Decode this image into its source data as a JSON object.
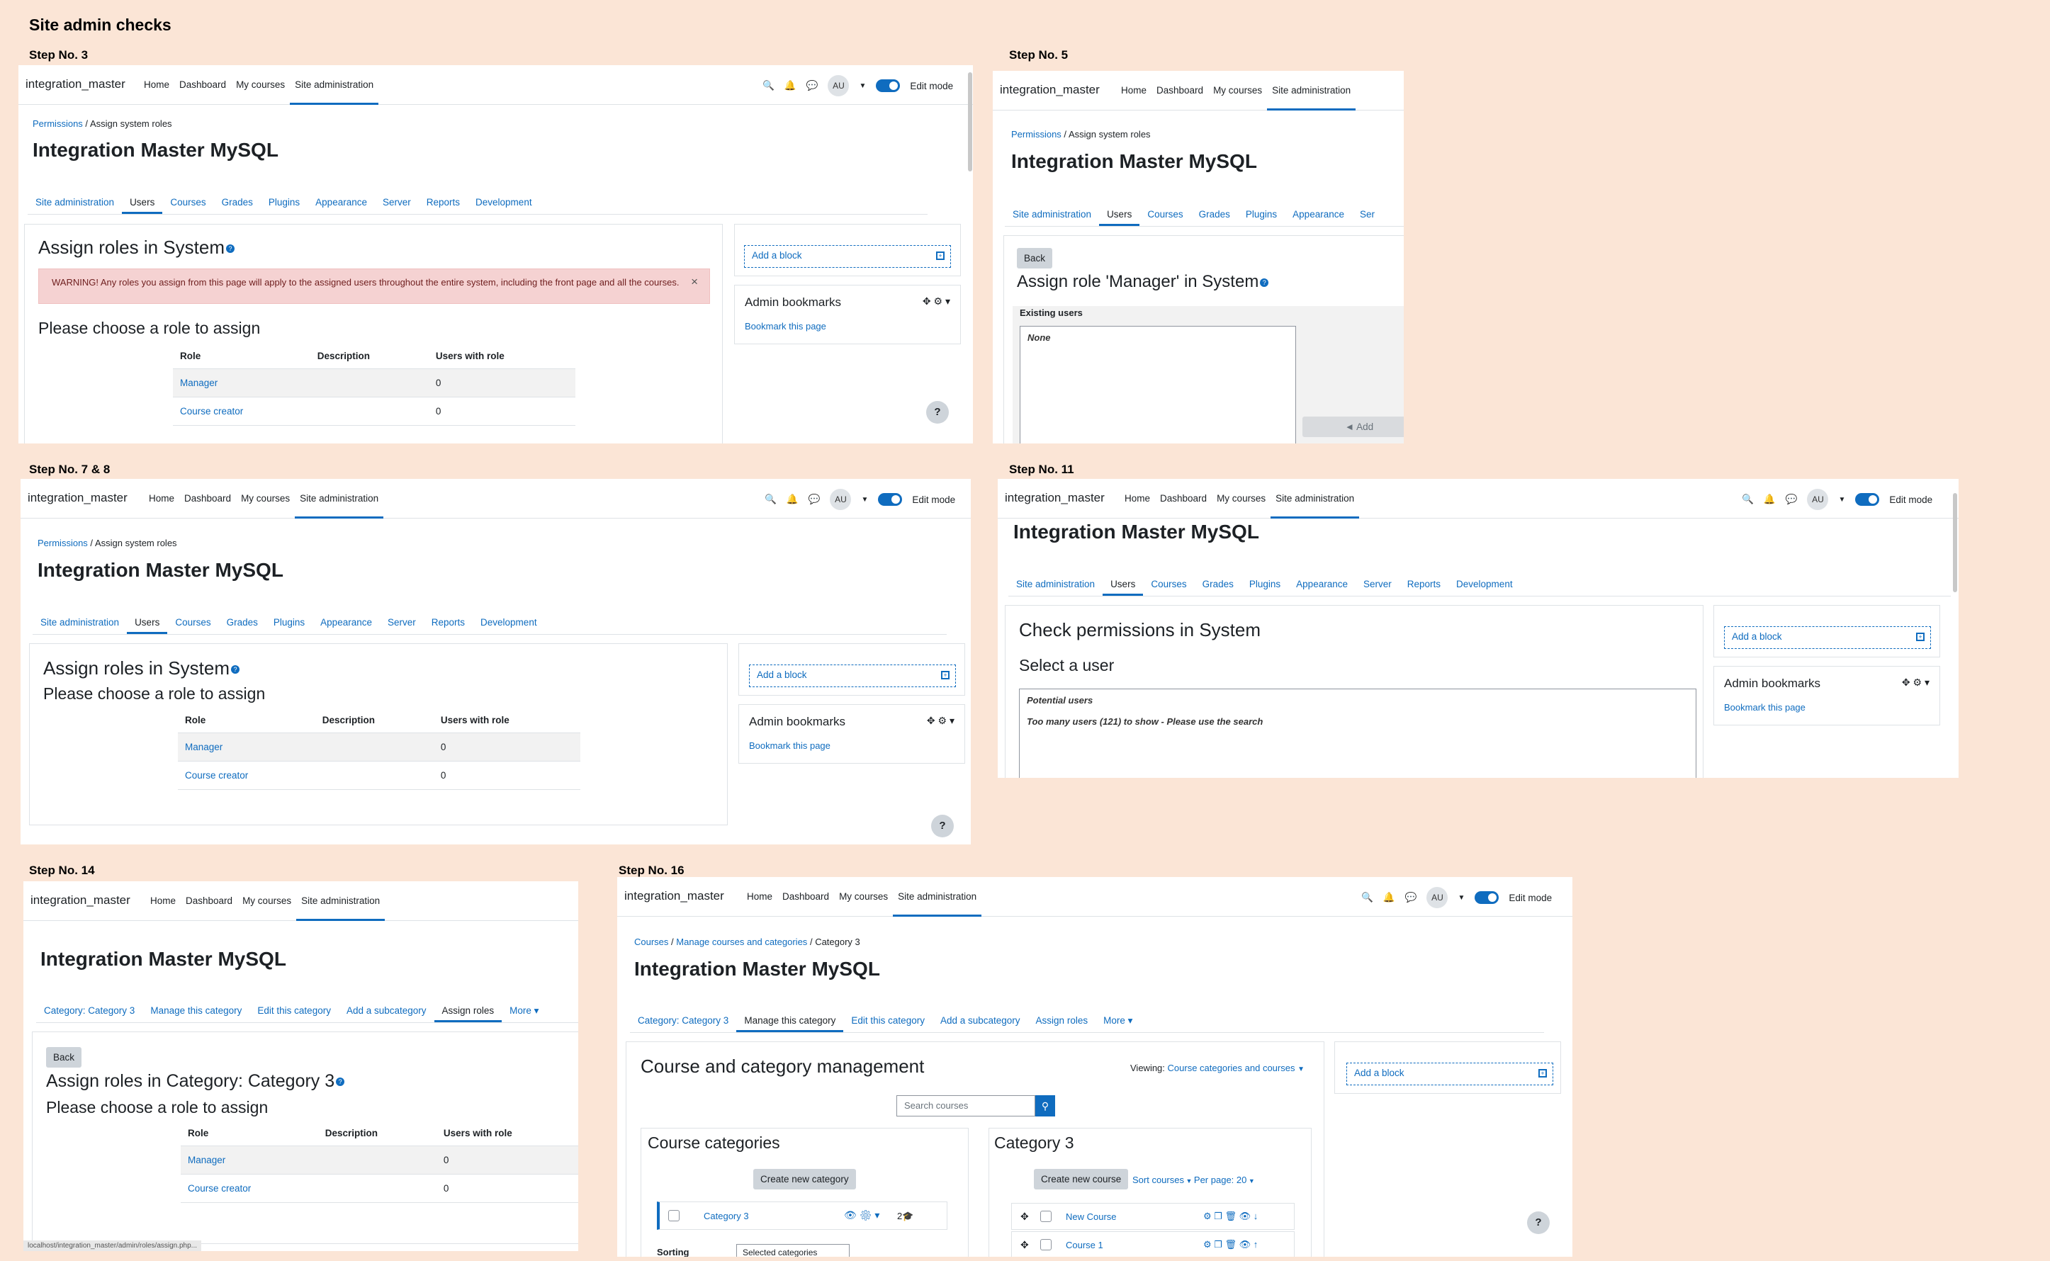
{
  "page_title": "Site admin checks",
  "nav": {
    "brand": "integration_master",
    "home": "Home",
    "dashboard": "Dashboard",
    "my_courses": "My courses",
    "site_admin": "Site administration",
    "avatar": "AU",
    "edit_mode": "Edit mode"
  },
  "common": {
    "h1": "Integration Master MySQL",
    "bc_permissions": "Permissions",
    "bc_sep": "/",
    "bc_assign": "Assign system roles",
    "add_block": "Add a block",
    "admin_bookmarks": "Admin bookmarks",
    "bookmark_page": "Bookmark this page",
    "help": "?",
    "th_role": "Role",
    "th_desc": "Description",
    "th_users": "Users with role",
    "role_manager": "Manager",
    "role_creator": "Course creator",
    "count_manager": "0",
    "count_creator": "0",
    "assign_roles_system": "Assign roles in System",
    "please_choose": "Please choose a role to assign",
    "back": "Back"
  },
  "admin_tabs": [
    "Site administration",
    "Users",
    "Courses",
    "Grades",
    "Plugins",
    "Appearance",
    "Server",
    "Reports",
    "Development"
  ],
  "step3": {
    "label": "Step No. 3",
    "warning": "WARNING! Any roles you assign from this page will apply to the assigned users throughout the entire system, including the front page and all the courses.",
    "close": "×"
  },
  "step5": {
    "label": "Step No. 5",
    "heading": "Assign role 'Manager' in System",
    "existing": "Existing users",
    "none": "None",
    "add": "◄ Add",
    "tab_partial": "Ser"
  },
  "step78": {
    "label": "Step No. 7 & 8"
  },
  "step11": {
    "label": "Step No. 11",
    "heading": "Check permissions in System",
    "select_user": "Select a user",
    "potential": "Potential users",
    "too_many": "Too many users (121) to show - Please use the search"
  },
  "step14": {
    "label": "Step No. 14",
    "heading": "Assign roles in Category: Category 3",
    "url": "localhost/integration_master/admin/roles/assign.php..."
  },
  "cat_tabs": [
    "Category: Category 3",
    "Manage this category",
    "Edit this category",
    "Add a subcategory",
    "Assign roles",
    "More ▾"
  ],
  "step16": {
    "label": "Step No. 16",
    "bc_courses": "Courses",
    "bc_manage": "Manage courses and categories",
    "bc_cat": "Category 3",
    "heading": "Course and category management",
    "viewing": "Viewing:",
    "viewing_value": "Course categories and courses",
    "search_placeholder": "Search courses",
    "course_categories": "Course categories",
    "create_category": "Create new category",
    "category3": "Category 3",
    "cat_count": "2",
    "sorting": "Sorting",
    "selected_categories": "Selected categories",
    "cat_heading": "Category 3",
    "create_course": "Create new course",
    "sort_courses": "Sort courses",
    "per_page": "Per page: 20",
    "course_new": "New Course",
    "course_1": "Course 1"
  }
}
